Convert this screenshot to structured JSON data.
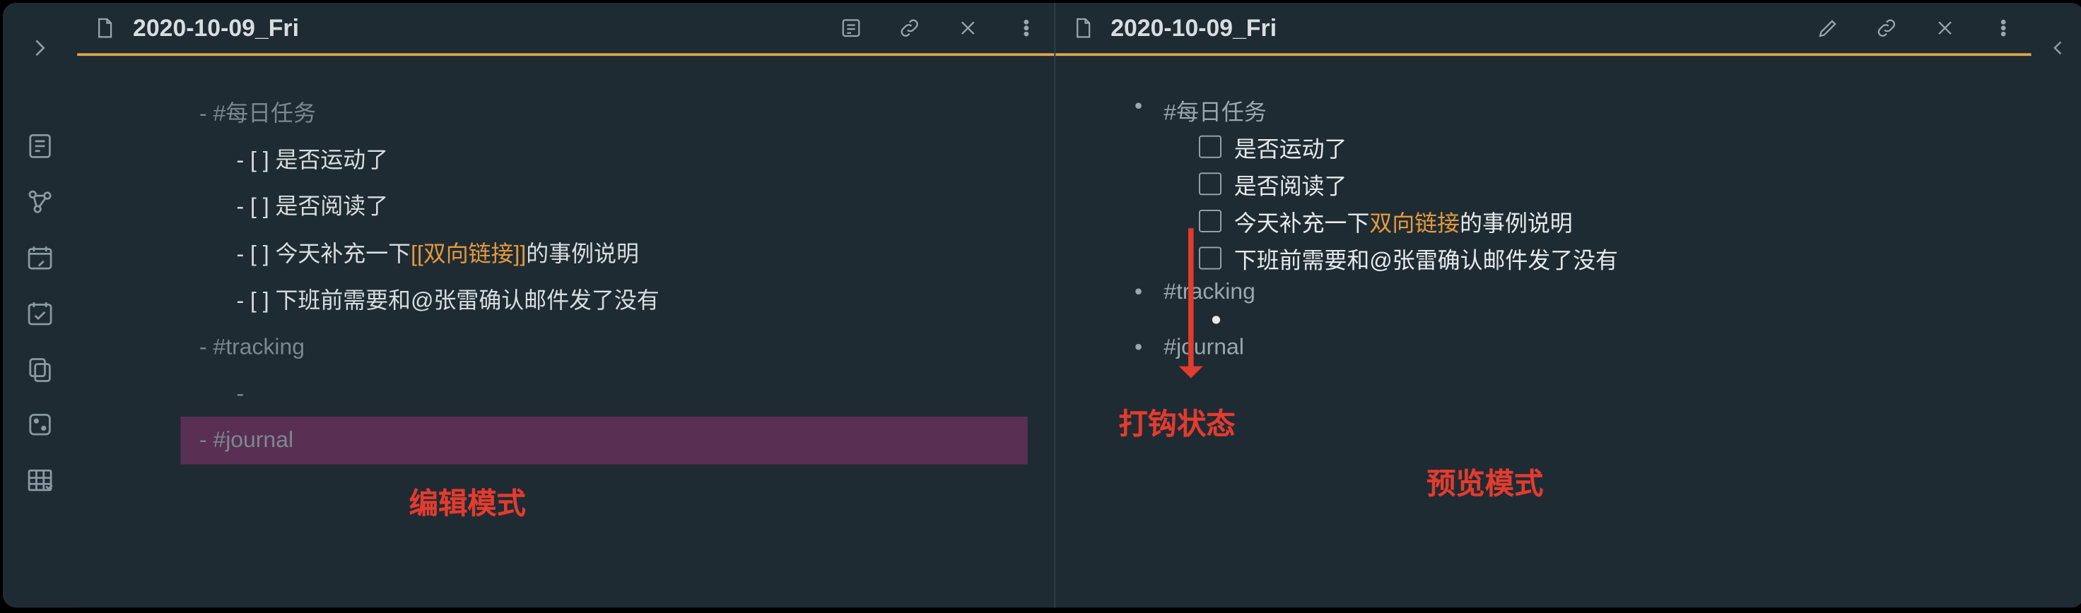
{
  "left_pane": {
    "title": "2020-10-09_Fri",
    "lines": {
      "h1": "- #每日任务",
      "t1": "- [ ] 是否运动了",
      "t2": "- [ ] 是否阅读了",
      "t3a": "- [ ] 今天补充一下",
      "t3link": "[[双向链接]]",
      "t3b": "的事例说明",
      "t4": "- [ ] 下班前需要和@张雷确认邮件发了没有",
      "h2": "- #tracking",
      "sub": "- ",
      "h3": "- #journal"
    },
    "annotation": "编辑模式"
  },
  "right_pane": {
    "title": "2020-10-09_Fri",
    "bullets": {
      "b1": "#每日任务",
      "b2": "#tracking",
      "b3": "#journal"
    },
    "tasks": {
      "t1": "是否运动了",
      "t2": "是否阅读了",
      "t3a": "今天补充一下",
      "t3link": "双向链接",
      "t3b": "的事例说明",
      "t4": "下班前需要和@张雷确认邮件发了没有"
    },
    "annotation_arrow": "打钩状态",
    "annotation_mode": "预览模式"
  },
  "icons": {
    "expand": "chevron-right",
    "file": "file",
    "notes": "notes",
    "graph": "graph",
    "calendar_note": "calendar-note",
    "checklist": "checklist",
    "copy": "copy",
    "dice": "dice",
    "table": "table",
    "preview": "preview",
    "link": "link",
    "close": "close",
    "more": "more",
    "edit": "pencil",
    "collapse": "chevron-left"
  }
}
